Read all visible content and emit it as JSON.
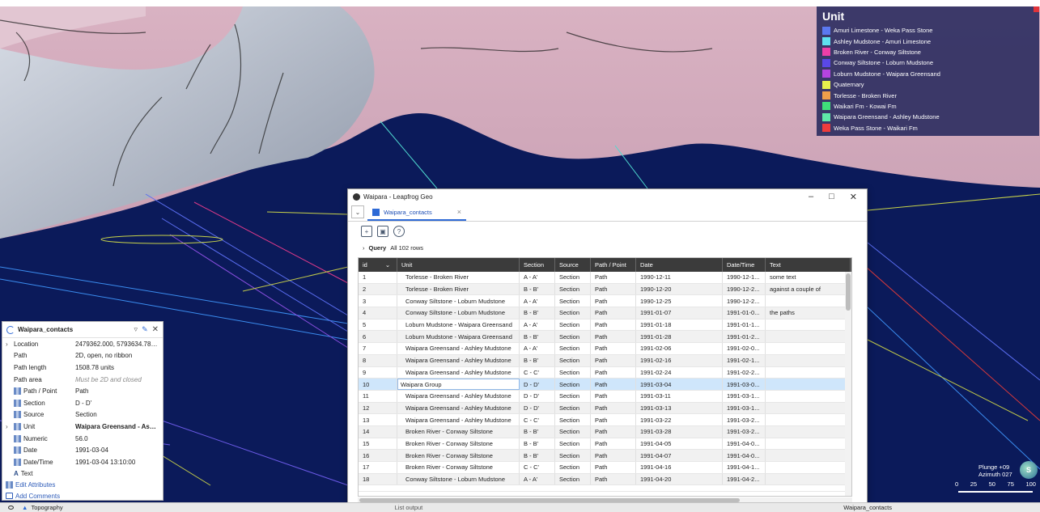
{
  "legend": {
    "title": "Unit",
    "items": [
      {
        "label": "Amuri Limestone - Weka Pass Stone",
        "color": "#5b78f0"
      },
      {
        "label": "Ashley Mudstone - Amuri Limestone",
        "color": "#5ee0f0"
      },
      {
        "label": "Broken River - Conway Siltstone",
        "color": "#ee3fa8"
      },
      {
        "label": "Conway Siltstone - Loburn Mudstone",
        "color": "#5a48e8"
      },
      {
        "label": "Loburn Mudstone - Waipara Greensand",
        "color": "#b544e0"
      },
      {
        "label": "Quaternary",
        "color": "#e6ef4c"
      },
      {
        "label": "Torlesse - Broken River",
        "color": "#f0a04a"
      },
      {
        "label": "Waikari Fm - Kowai Fm",
        "color": "#3fe07a"
      },
      {
        "label": "Waipara Greensand - Ashley Mudstone",
        "color": "#5fe8a8"
      },
      {
        "label": "Weka Pass Stone - Waikari Fm",
        "color": "#ee3c3c"
      }
    ]
  },
  "props": {
    "title": "Waipara_contacts",
    "rows": [
      {
        "label": "Location",
        "value": "2479362.000, 5793634.781, -3...",
        "caret": true
      },
      {
        "label": "Path",
        "value": "2D, open, no ribbon"
      },
      {
        "label": "Path length",
        "value": "1508.78 units"
      },
      {
        "label": "Path area",
        "value": "Must be 2D and closed"
      },
      {
        "label": "Path / Point",
        "value": "Path",
        "icon": true
      },
      {
        "label": "Section",
        "value": "D - D'",
        "icon": true
      },
      {
        "label": "Source",
        "value": "Section",
        "icon": true
      },
      {
        "label": "Unit",
        "value": "Waipara Greensand - Ashley ...",
        "icon": true,
        "caret": true
      },
      {
        "label": "Numeric",
        "value": "56.0",
        "icon": true
      },
      {
        "label": "Date",
        "value": "1991-03-04",
        "icon": true
      },
      {
        "label": "Date/Time",
        "value": "1991-03-04 13:10:00",
        "icon": true
      },
      {
        "label": "Text",
        "value": "",
        "icon": "A"
      }
    ],
    "edit_attributes": "Edit Attributes",
    "add_comments": "Add Comments"
  },
  "dialog": {
    "title": "Waipara - Leapfrog Geo",
    "tab": "Waipara_contacts",
    "query_label": "Query",
    "query_rows": "All 102 rows",
    "columns": [
      "id",
      "Unit",
      "Section",
      "Source",
      "Path / Point",
      "Date",
      "Date/Time",
      "Text"
    ],
    "rows": [
      [
        "1",
        "Torlesse - Broken River",
        "A - A'",
        "Section",
        "Path",
        "1990-12-11",
        "1990-12-1...",
        "some text"
      ],
      [
        "2",
        "Torlesse - Broken River",
        "B - B'",
        "Section",
        "Path",
        "1990-12-20",
        "1990-12-2...",
        "against a couple of"
      ],
      [
        "3",
        "Conway Siltstone - Loburn Mudstone",
        "A - A'",
        "Section",
        "Path",
        "1990-12-25",
        "1990-12-2...",
        ""
      ],
      [
        "4",
        "Conway Siltstone - Loburn Mudstone",
        "B - B'",
        "Section",
        "Path",
        "1991-01-07",
        "1991-01-0...",
        "the paths"
      ],
      [
        "5",
        "Loburn Mudstone - Waipara Greensand",
        "A - A'",
        "Section",
        "Path",
        "1991-01-18",
        "1991-01-1...",
        ""
      ],
      [
        "6",
        "Loburn Mudstone - Waipara Greensand",
        "B - B'",
        "Section",
        "Path",
        "1991-01-28",
        "1991-01-2...",
        ""
      ],
      [
        "7",
        "Waipara Greensand - Ashley Mudstone",
        "A - A'",
        "Section",
        "Path",
        "1991-02-06",
        "1991-02-0...",
        ""
      ],
      [
        "8",
        "Waipara Greensand - Ashley Mudstone",
        "B - B'",
        "Section",
        "Path",
        "1991-02-16",
        "1991-02-1...",
        ""
      ],
      [
        "9",
        "Waipara Greensand - Ashley Mudstone",
        "C - C'",
        "Section",
        "Path",
        "1991-02-24",
        "1991-02-2...",
        ""
      ],
      [
        "10",
        "Waipara Group",
        "D - D'",
        "Section",
        "Path",
        "1991-03-04",
        "1991-03-0...",
        ""
      ],
      [
        "11",
        "Waipara Greensand - Ashley Mudstone",
        "D - D'",
        "Section",
        "Path",
        "1991-03-11",
        "1991-03-1...",
        ""
      ],
      [
        "12",
        "Waipara Greensand - Ashley Mudstone",
        "D - D'",
        "Section",
        "Path",
        "1991-03-13",
        "1991-03-1...",
        ""
      ],
      [
        "13",
        "Waipara Greensand - Ashley Mudstone",
        "C - C'",
        "Section",
        "Path",
        "1991-03-22",
        "1991-03-2...",
        ""
      ],
      [
        "14",
        "Broken River - Conway Siltstone",
        "B - B'",
        "Section",
        "Path",
        "1991-03-28",
        "1991-03-2...",
        ""
      ],
      [
        "15",
        "Broken River - Conway Siltstone",
        "B - B'",
        "Section",
        "Path",
        "1991-04-05",
        "1991-04-0...",
        ""
      ],
      [
        "16",
        "Broken River - Conway Siltstone",
        "B - B'",
        "Section",
        "Path",
        "1991-04-07",
        "1991-04-0...",
        ""
      ],
      [
        "17",
        "Broken River - Conway Siltstone",
        "C - C'",
        "Section",
        "Path",
        "1991-04-16",
        "1991-04-1...",
        ""
      ],
      [
        "18",
        "Conway Siltstone - Loburn Mudstone",
        "A - A'",
        "Section",
        "Path",
        "1991-04-20",
        "1991-04-2...",
        ""
      ]
    ],
    "selected_row": 9
  },
  "compass": {
    "plunge": "Plunge +09",
    "azimuth": "Azimuth 027",
    "letter": "S",
    "ticks": [
      "0",
      "25",
      "50",
      "75",
      "100"
    ]
  },
  "bottom": {
    "topography": "Topography",
    "list_output": "List output",
    "waipara_contacts": "Waipara_contacts"
  }
}
